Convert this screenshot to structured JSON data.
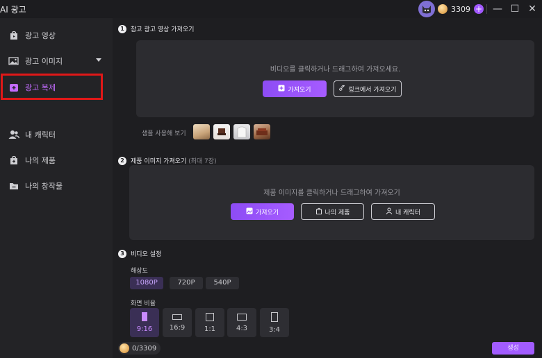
{
  "app": {
    "title": "AI 광고",
    "credits": "3309",
    "avatar_icon": "cat-avatar-icon"
  },
  "sidebar": {
    "items": [
      {
        "label": "광고 영상",
        "icon": "video-bag-icon"
      },
      {
        "label": "광고 이미지",
        "icon": "image-icon"
      },
      {
        "label": "광고 복제",
        "icon": "clone-icon"
      },
      {
        "label": "내 캐릭터",
        "icon": "people-icon"
      },
      {
        "label": "나의 제품",
        "icon": "product-bag-icon"
      },
      {
        "label": "나의 창작물",
        "icon": "folder-icon"
      }
    ],
    "active_index": 2
  },
  "section1": {
    "num": "1",
    "title": "참고 광고 영상 가져오기",
    "hint": "비디오를 클릭하거나 드래그하여 가져오세요.",
    "import_label": "가져오기",
    "link_label": "링크에서 가져오기",
    "sample_label": "샘플 사용해 보기"
  },
  "section2": {
    "num": "2",
    "title": "제품 이미지 가져오기",
    "subtitle": "(최대 7장)",
    "hint": "제품 이미지를 클릭하거나 드래그하여 가져오기",
    "import_label": "가져오기",
    "products_label": "나의 제품",
    "character_label": "내 캐릭터"
  },
  "section3": {
    "num": "3",
    "title": "비디오 설정",
    "resolution_label": "해상도",
    "resolutions": [
      "1080P",
      "720P",
      "540P"
    ],
    "selected_resolution": "1080P",
    "ratio_label": "화면 비율",
    "ratios": [
      "9:16",
      "16:9",
      "1:1",
      "4:3",
      "3:4"
    ],
    "selected_ratio": "9:16"
  },
  "footer": {
    "credit_text": "0/3309",
    "generate_label": "생성"
  },
  "colors": {
    "accent": "#a25cff",
    "highlight": "#e01818"
  }
}
